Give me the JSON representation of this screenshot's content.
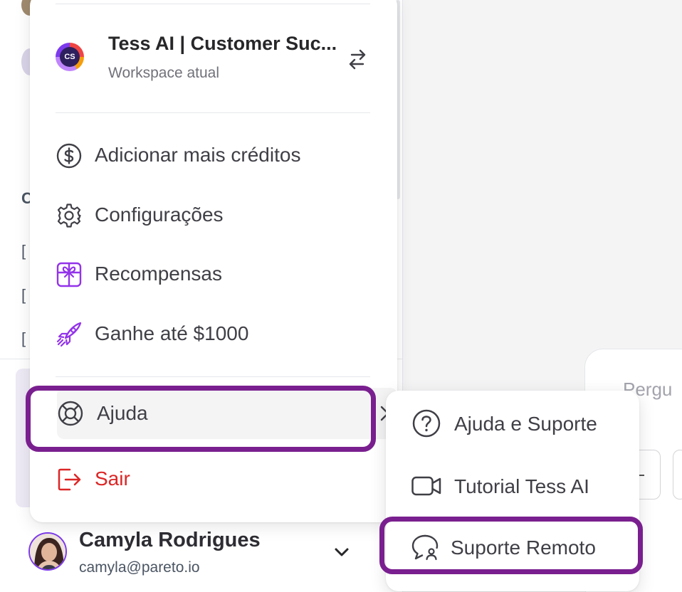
{
  "workspace": {
    "name": "Tess AI | Customer Suc...",
    "subtitle": "Workspace atual",
    "logo_text": "CS"
  },
  "menu": {
    "add_credits": "Adicionar mais créditos",
    "settings": "Configurações",
    "rewards": "Recompensas",
    "earn": "Ganhe até $1000",
    "help": "Ajuda",
    "logout": "Sair"
  },
  "submenu": {
    "help_support": "Ajuda e Suporte",
    "tutorial": "Tutorial Tess AI",
    "remote_support": "Suporte Remoto"
  },
  "user": {
    "name": "Camyla Rodrigues",
    "email": "camyla@pareto.io"
  },
  "main": {
    "prompt_placeholder": "Pergu"
  },
  "colors": {
    "highlight": "#7a1f8f",
    "logout": "#dc2626",
    "rewards_icon": "#9333ea"
  }
}
